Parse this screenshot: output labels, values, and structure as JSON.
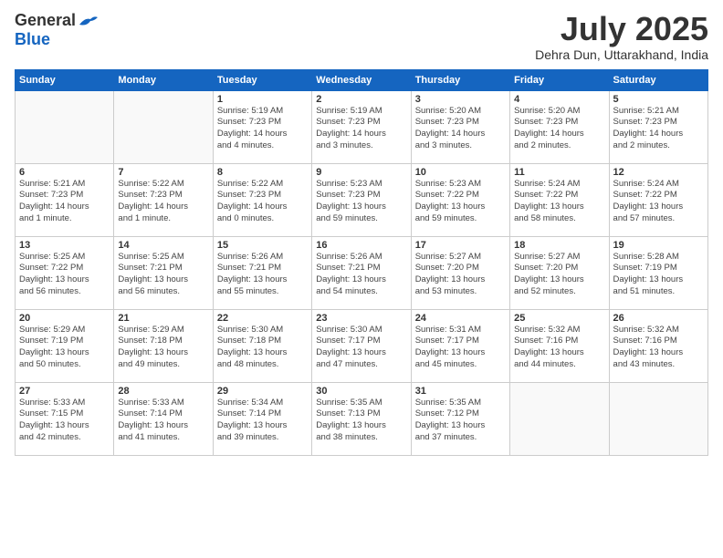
{
  "header": {
    "logo_general": "General",
    "logo_blue": "Blue",
    "month_title": "July 2025",
    "location": "Dehra Dun, Uttarakhand, India"
  },
  "days_of_week": [
    "Sunday",
    "Monday",
    "Tuesday",
    "Wednesday",
    "Thursday",
    "Friday",
    "Saturday"
  ],
  "weeks": [
    [
      {
        "day": "",
        "info": ""
      },
      {
        "day": "",
        "info": ""
      },
      {
        "day": "1",
        "info": "Sunrise: 5:19 AM\nSunset: 7:23 PM\nDaylight: 14 hours\nand 4 minutes."
      },
      {
        "day": "2",
        "info": "Sunrise: 5:19 AM\nSunset: 7:23 PM\nDaylight: 14 hours\nand 3 minutes."
      },
      {
        "day": "3",
        "info": "Sunrise: 5:20 AM\nSunset: 7:23 PM\nDaylight: 14 hours\nand 3 minutes."
      },
      {
        "day": "4",
        "info": "Sunrise: 5:20 AM\nSunset: 7:23 PM\nDaylight: 14 hours\nand 2 minutes."
      },
      {
        "day": "5",
        "info": "Sunrise: 5:21 AM\nSunset: 7:23 PM\nDaylight: 14 hours\nand 2 minutes."
      }
    ],
    [
      {
        "day": "6",
        "info": "Sunrise: 5:21 AM\nSunset: 7:23 PM\nDaylight: 14 hours\nand 1 minute."
      },
      {
        "day": "7",
        "info": "Sunrise: 5:22 AM\nSunset: 7:23 PM\nDaylight: 14 hours\nand 1 minute."
      },
      {
        "day": "8",
        "info": "Sunrise: 5:22 AM\nSunset: 7:23 PM\nDaylight: 14 hours\nand 0 minutes."
      },
      {
        "day": "9",
        "info": "Sunrise: 5:23 AM\nSunset: 7:23 PM\nDaylight: 13 hours\nand 59 minutes."
      },
      {
        "day": "10",
        "info": "Sunrise: 5:23 AM\nSunset: 7:22 PM\nDaylight: 13 hours\nand 59 minutes."
      },
      {
        "day": "11",
        "info": "Sunrise: 5:24 AM\nSunset: 7:22 PM\nDaylight: 13 hours\nand 58 minutes."
      },
      {
        "day": "12",
        "info": "Sunrise: 5:24 AM\nSunset: 7:22 PM\nDaylight: 13 hours\nand 57 minutes."
      }
    ],
    [
      {
        "day": "13",
        "info": "Sunrise: 5:25 AM\nSunset: 7:22 PM\nDaylight: 13 hours\nand 56 minutes."
      },
      {
        "day": "14",
        "info": "Sunrise: 5:25 AM\nSunset: 7:21 PM\nDaylight: 13 hours\nand 56 minutes."
      },
      {
        "day": "15",
        "info": "Sunrise: 5:26 AM\nSunset: 7:21 PM\nDaylight: 13 hours\nand 55 minutes."
      },
      {
        "day": "16",
        "info": "Sunrise: 5:26 AM\nSunset: 7:21 PM\nDaylight: 13 hours\nand 54 minutes."
      },
      {
        "day": "17",
        "info": "Sunrise: 5:27 AM\nSunset: 7:20 PM\nDaylight: 13 hours\nand 53 minutes."
      },
      {
        "day": "18",
        "info": "Sunrise: 5:27 AM\nSunset: 7:20 PM\nDaylight: 13 hours\nand 52 minutes."
      },
      {
        "day": "19",
        "info": "Sunrise: 5:28 AM\nSunset: 7:19 PM\nDaylight: 13 hours\nand 51 minutes."
      }
    ],
    [
      {
        "day": "20",
        "info": "Sunrise: 5:29 AM\nSunset: 7:19 PM\nDaylight: 13 hours\nand 50 minutes."
      },
      {
        "day": "21",
        "info": "Sunrise: 5:29 AM\nSunset: 7:18 PM\nDaylight: 13 hours\nand 49 minutes."
      },
      {
        "day": "22",
        "info": "Sunrise: 5:30 AM\nSunset: 7:18 PM\nDaylight: 13 hours\nand 48 minutes."
      },
      {
        "day": "23",
        "info": "Sunrise: 5:30 AM\nSunset: 7:17 PM\nDaylight: 13 hours\nand 47 minutes."
      },
      {
        "day": "24",
        "info": "Sunrise: 5:31 AM\nSunset: 7:17 PM\nDaylight: 13 hours\nand 45 minutes."
      },
      {
        "day": "25",
        "info": "Sunrise: 5:32 AM\nSunset: 7:16 PM\nDaylight: 13 hours\nand 44 minutes."
      },
      {
        "day": "26",
        "info": "Sunrise: 5:32 AM\nSunset: 7:16 PM\nDaylight: 13 hours\nand 43 minutes."
      }
    ],
    [
      {
        "day": "27",
        "info": "Sunrise: 5:33 AM\nSunset: 7:15 PM\nDaylight: 13 hours\nand 42 minutes."
      },
      {
        "day": "28",
        "info": "Sunrise: 5:33 AM\nSunset: 7:14 PM\nDaylight: 13 hours\nand 41 minutes."
      },
      {
        "day": "29",
        "info": "Sunrise: 5:34 AM\nSunset: 7:14 PM\nDaylight: 13 hours\nand 39 minutes."
      },
      {
        "day": "30",
        "info": "Sunrise: 5:35 AM\nSunset: 7:13 PM\nDaylight: 13 hours\nand 38 minutes."
      },
      {
        "day": "31",
        "info": "Sunrise: 5:35 AM\nSunset: 7:12 PM\nDaylight: 13 hours\nand 37 minutes."
      },
      {
        "day": "",
        "info": ""
      },
      {
        "day": "",
        "info": ""
      }
    ]
  ]
}
